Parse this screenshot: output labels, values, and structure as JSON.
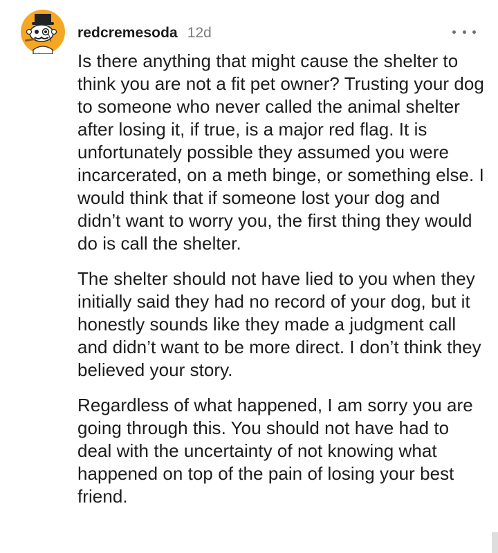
{
  "comment": {
    "author": "redcremesoda",
    "age": "12d",
    "avatar_icon": "snoo-avatar-icon",
    "more_icon": "more-options-icon",
    "paragraphs": [
      "Is there anything that might cause the shelter to think you are not a fit pet owner? Trusting your dog to someone who never called the animal shelter after losing it, if true, is a major red flag. It is unfortunately possible they assumed you were incarcerated, on a meth binge, or something else. I would think that if someone lost your dog and didn’t want to worry you, the first thing they would do is call the shelter.",
      "The shelter should not have lied to you when they initially said they had no record of your dog, but it honestly sounds like they made a judgment call and didn’t want to be more direct. I don’t think they believed your story.",
      "Regardless of what happened, I am sorry you are going through this. You should not have had to deal with the uncertainty of not knowing what happened on top of the pain of losing your best friend."
    ]
  },
  "colors": {
    "avatar_background": "#f5a623",
    "avatar_face": "#ffffff",
    "text_primary": "#1c1c1c",
    "text_secondary": "#7c7c7c"
  }
}
